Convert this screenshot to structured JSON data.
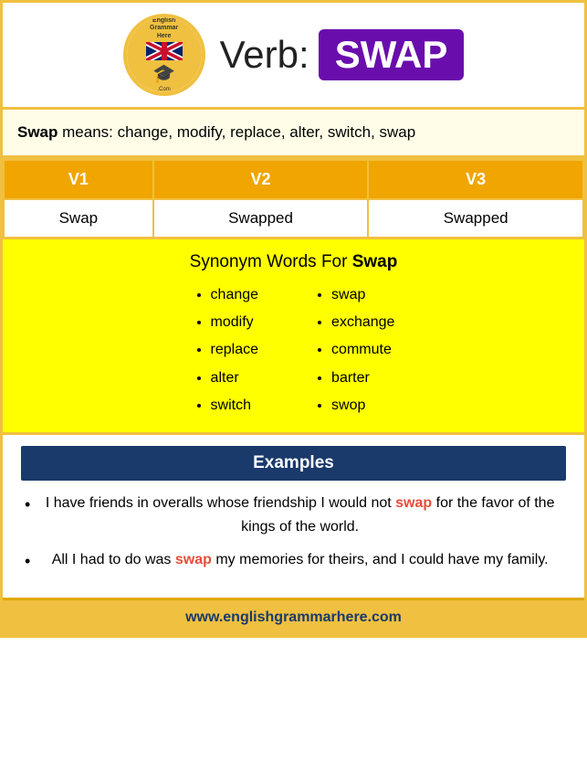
{
  "header": {
    "verb_label": "Verb:",
    "word_badge": "SWAP",
    "logo_top_text": "English Grammar Here.Com",
    "logo_bottom_text": ".Com"
  },
  "definition": {
    "bold_word": "Swap",
    "text": " means: change, modify, replace, alter, switch, swap"
  },
  "table": {
    "headers": [
      "V1",
      "V2",
      "V3"
    ],
    "rows": [
      [
        "Swap",
        "Swapped",
        "Swapped"
      ]
    ]
  },
  "synonyms": {
    "title_plain": "Synonym Words For ",
    "title_bold": "Swap",
    "column1": [
      "change",
      "modify",
      "replace",
      "alter",
      "switch"
    ],
    "column2": [
      "swap",
      "exchange",
      "commute",
      "barter",
      "swop"
    ]
  },
  "examples_header": "Examples",
  "examples": [
    {
      "plain1": "I have friends in overalls whose friendship I would not ",
      "highlight": "swap",
      "plain2": " for the favor of the kings of the world."
    },
    {
      "plain1": "All I had to do was ",
      "highlight": "swap",
      "plain2": " my memories for theirs, and I could have my family."
    }
  ],
  "footer": {
    "url": "www.englishgrammarhere.com"
  }
}
